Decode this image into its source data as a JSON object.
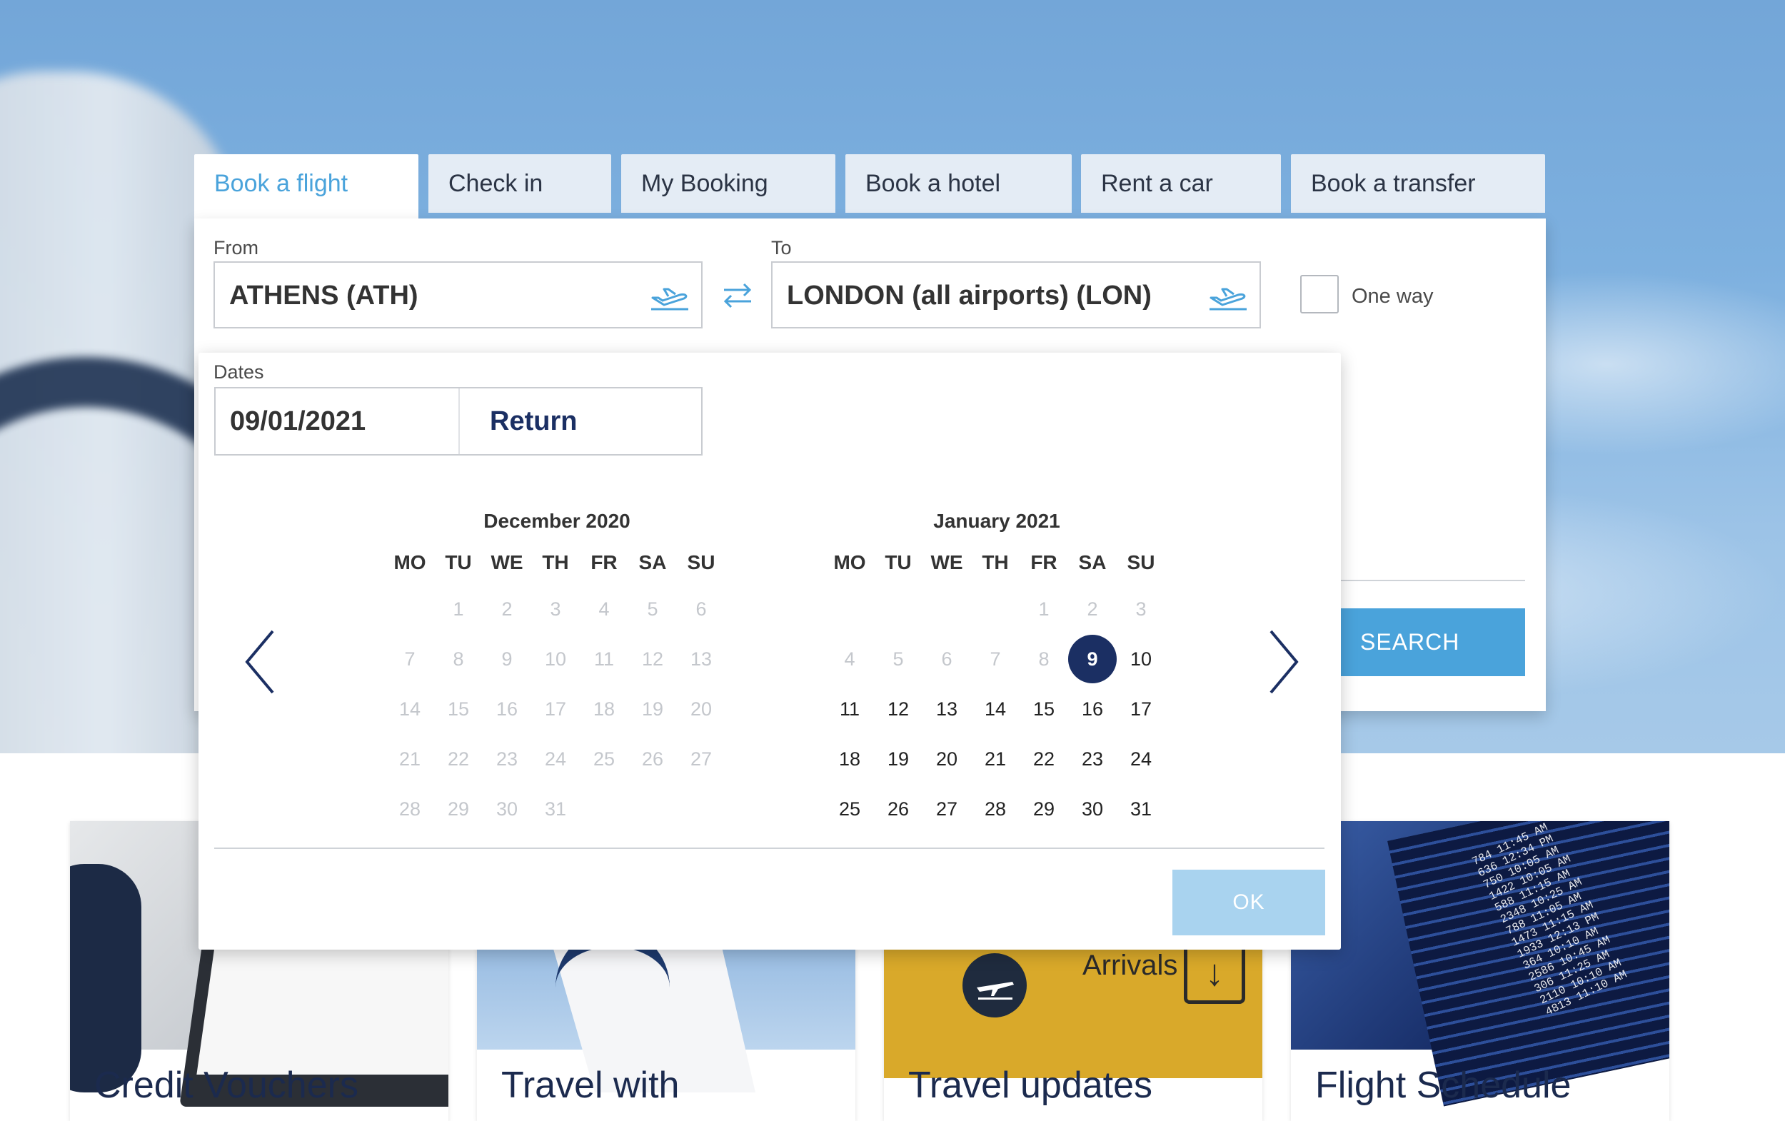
{
  "tabs": [
    "Book a flight",
    "Check in",
    "My Booking",
    "Book a hotel",
    "Rent a car",
    "Book a transfer"
  ],
  "form": {
    "from_label": "From",
    "from_value": "ATHENS (ATH)",
    "to_label": "To",
    "to_value": "LONDON (all airports) (LON)",
    "one_way_label": "One way",
    "one_way_checked": false,
    "dates_label": "Dates",
    "departure_date": "09/01/2021",
    "return_label": "Return",
    "search_label": "SEARCH"
  },
  "calendar": {
    "weekdays": [
      "MO",
      "TU",
      "WE",
      "TH",
      "FR",
      "SA",
      "SU"
    ],
    "months": [
      {
        "title": "December 2020",
        "first_weekday": 1,
        "days": 31,
        "disabled_through": 31,
        "selected": null
      },
      {
        "title": "January 2021",
        "first_weekday": 4,
        "days": 31,
        "disabled_through": 8,
        "selected": 9
      }
    ],
    "ok_label": "OK"
  },
  "cards": [
    {
      "title": "Credit Vouchers"
    },
    {
      "title": "Travel with"
    },
    {
      "title": "Travel updates"
    },
    {
      "title": "Flight Schedule"
    }
  ],
  "card3_sign_text": "Arrivals",
  "card4_board_text": "784 11:45 AM\n636 12:34 PM\n750 10:05 AM\n1422 10:05 AM\n588 11:15 AM\n2348 10:25 AM\n788 11:05 AM\n1473 11:15 AM\n1933 12:13 PM\n364 10:10 AM\n2586 10:45 AM\n306 11:25 AM\n2110 10:10 AM\n4813 11:10 AM",
  "colors": {
    "accent": "#4aa3db",
    "navy": "#1b2f63",
    "tab_bg": "#e4ecf5"
  },
  "icons": {
    "airport": "plane-takeoff-icon",
    "swap": "swap-arrows-icon",
    "prev": "chevron-left-icon",
    "next": "chevron-right-icon"
  }
}
